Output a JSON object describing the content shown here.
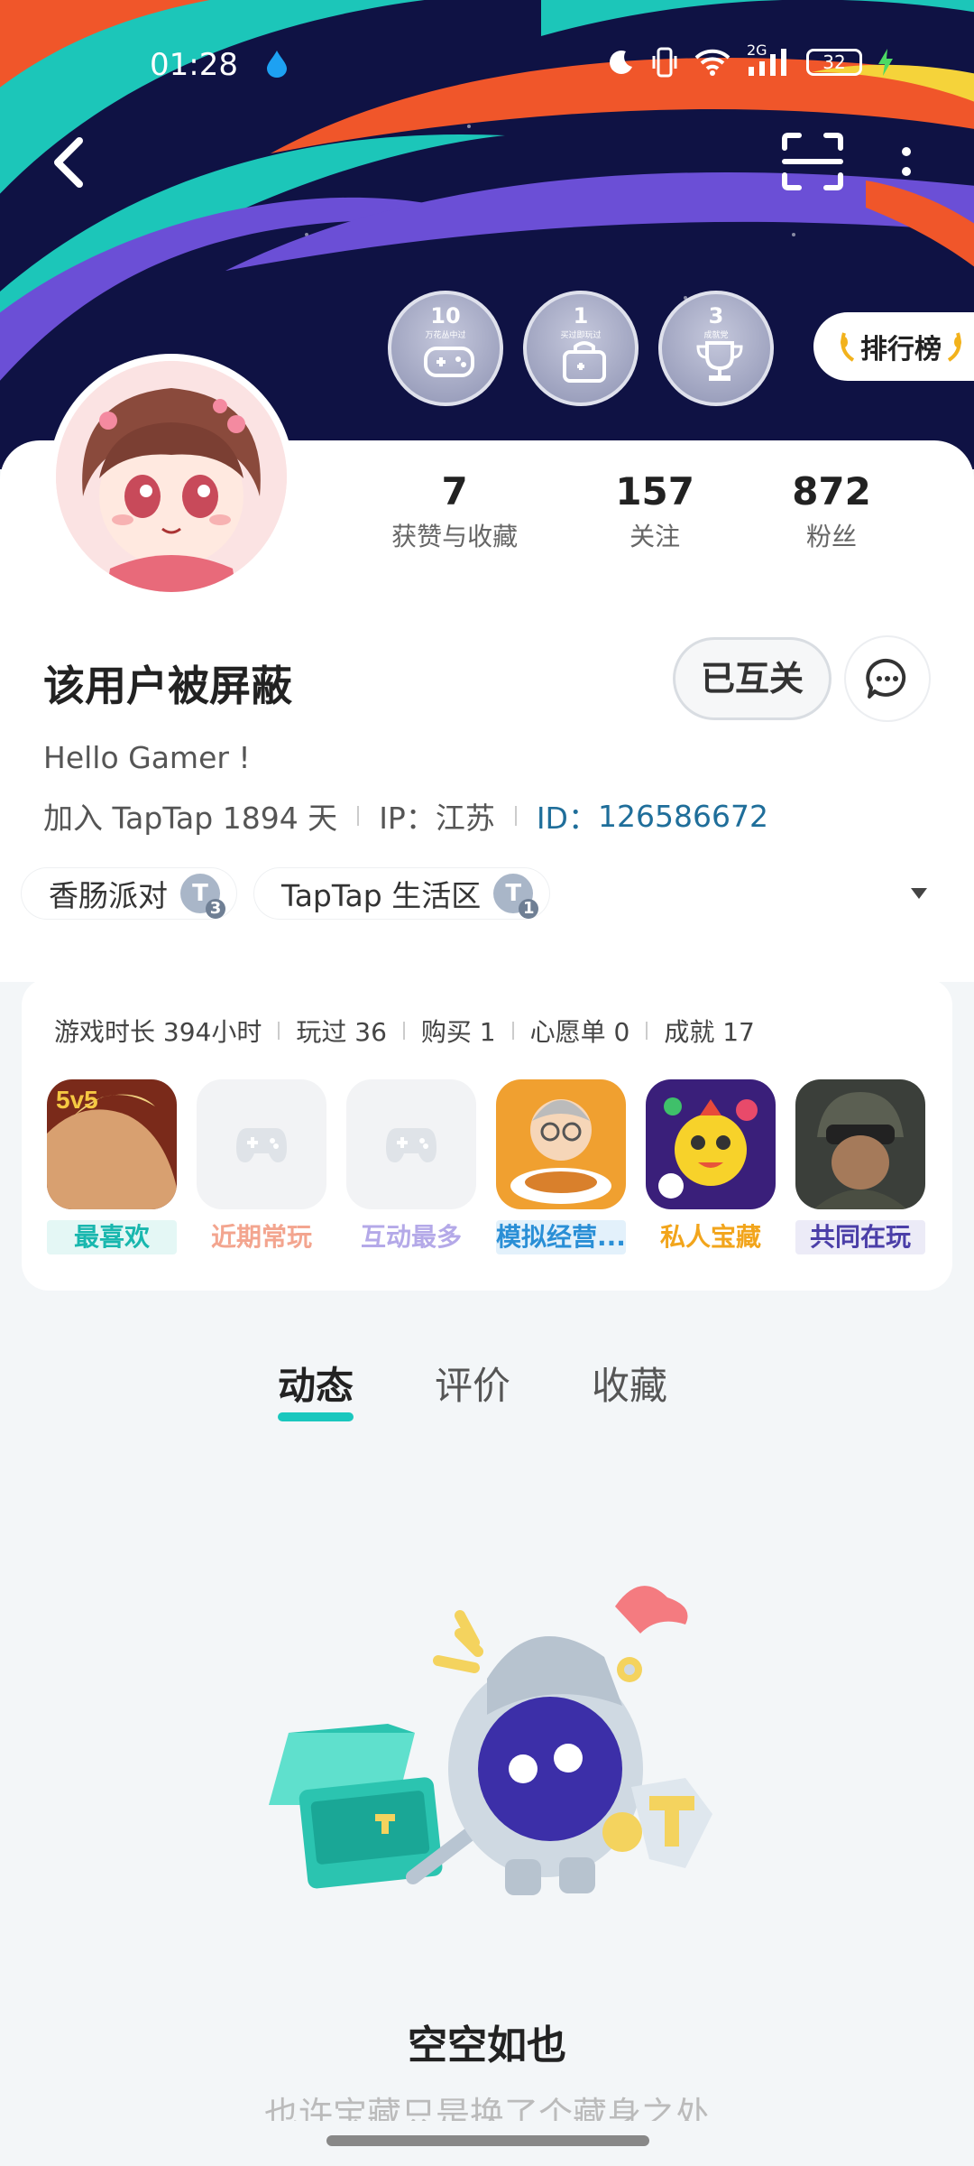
{
  "status_bar": {
    "time": "01:28",
    "network": "2G",
    "battery": "32"
  },
  "header": {
    "back_icon": "chevron-left-icon",
    "scan_icon": "scan-icon",
    "more_icon": "more-vertical-icon",
    "badges": [
      {
        "count": "10",
        "caption": "万花丛中过",
        "icon": "gamepad-icon"
      },
      {
        "count": "1",
        "caption": "买过即玩过",
        "icon": "bag-icon"
      },
      {
        "count": "3",
        "caption": "成就党",
        "icon": "trophy-icon"
      }
    ],
    "rank_label": "排行榜"
  },
  "profile": {
    "stats": [
      {
        "value": "7",
        "label": "获赞与收藏"
      },
      {
        "value": "157",
        "label": "关注"
      },
      {
        "value": "872",
        "label": "粉丝"
      }
    ],
    "username": "该用户被屏蔽",
    "mutual_label": "已互关",
    "bio": "Hello Gamer !",
    "join_text": "加入 TapTap 1894 天",
    "ip_text": "IP：江苏",
    "id_label": "ID：",
    "id_value": "126586672",
    "tags": [
      {
        "label": "香肠派对",
        "level": "3"
      },
      {
        "label": "TapTap 生活区",
        "level": "1"
      }
    ]
  },
  "game_card": {
    "stats": [
      "游戏时长 394小时",
      "玩过 36",
      "购买 1",
      "心愿单 0",
      "成就 17"
    ],
    "games": [
      {
        "label": "最喜欢",
        "color": "#19b7ae",
        "bg": "#e4f7f5"
      },
      {
        "label": "近期常玩",
        "color": "#f3a58f",
        "bg": "#ffffff"
      },
      {
        "label": "互动最多",
        "color": "#b4a9e8",
        "bg": "#ffffff"
      },
      {
        "label": "模拟经营...",
        "color": "#2a8fd6",
        "bg": "#e3f1fb"
      },
      {
        "label": "私人宝藏",
        "color": "#f2a51c",
        "bg": "#ffffff"
      },
      {
        "label": "共同在玩",
        "color": "#4b3fa8",
        "bg": "#ecebf7"
      }
    ]
  },
  "tabs": [
    "动态",
    "评价",
    "收藏"
  ],
  "empty_state": {
    "title": "空空如也",
    "subtitle": "也许宝藏只是换了个藏身之处"
  },
  "colors": {
    "accent": "#19c7be",
    "link": "#1f6e9a"
  }
}
